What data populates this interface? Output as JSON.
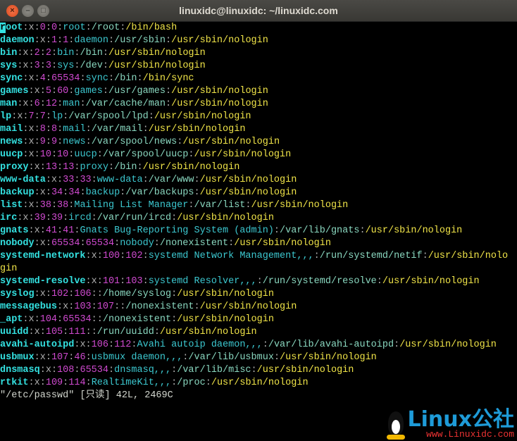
{
  "window": {
    "title": "linuxidc@linuxidc: ~/linuxidc.com"
  },
  "entries": [
    [
      "root",
      "x",
      "0",
      "0",
      "root",
      "/root",
      "/bin/bash"
    ],
    [
      "daemon",
      "x",
      "1",
      "1",
      "daemon",
      "/usr/sbin",
      "/usr/sbin/nologin"
    ],
    [
      "bin",
      "x",
      "2",
      "2",
      "bin",
      "/bin",
      "/usr/sbin/nologin"
    ],
    [
      "sys",
      "x",
      "3",
      "3",
      "sys",
      "/dev",
      "/usr/sbin/nologin"
    ],
    [
      "sync",
      "x",
      "4",
      "65534",
      "sync",
      "/bin",
      "/bin/sync"
    ],
    [
      "games",
      "x",
      "5",
      "60",
      "games",
      "/usr/games",
      "/usr/sbin/nologin"
    ],
    [
      "man",
      "x",
      "6",
      "12",
      "man",
      "/var/cache/man",
      "/usr/sbin/nologin"
    ],
    [
      "lp",
      "x",
      "7",
      "7",
      "lp",
      "/var/spool/lpd",
      "/usr/sbin/nologin"
    ],
    [
      "mail",
      "x",
      "8",
      "8",
      "mail",
      "/var/mail",
      "/usr/sbin/nologin"
    ],
    [
      "news",
      "x",
      "9",
      "9",
      "news",
      "/var/spool/news",
      "/usr/sbin/nologin"
    ],
    [
      "uucp",
      "x",
      "10",
      "10",
      "uucp",
      "/var/spool/uucp",
      "/usr/sbin/nologin"
    ],
    [
      "proxy",
      "x",
      "13",
      "13",
      "proxy",
      "/bin",
      "/usr/sbin/nologin"
    ],
    [
      "www-data",
      "x",
      "33",
      "33",
      "www-data",
      "/var/www",
      "/usr/sbin/nologin"
    ],
    [
      "backup",
      "x",
      "34",
      "34",
      "backup",
      "/var/backups",
      "/usr/sbin/nologin"
    ],
    [
      "list",
      "x",
      "38",
      "38",
      "Mailing List Manager",
      "/var/list",
      "/usr/sbin/nologin"
    ],
    [
      "irc",
      "x",
      "39",
      "39",
      "ircd",
      "/var/run/ircd",
      "/usr/sbin/nologin"
    ],
    [
      "gnats",
      "x",
      "41",
      "41",
      "Gnats Bug-Reporting System (admin)",
      "/var/lib/gnats",
      "/usr/sbin/nologin"
    ],
    [
      "nobody",
      "x",
      "65534",
      "65534",
      "nobody",
      "/nonexistent",
      "/usr/sbin/nologin"
    ],
    [
      "systemd-network",
      "x",
      "100",
      "102",
      "systemd Network Management,,,",
      "/run/systemd/netif",
      "/usr/sbin/nologin"
    ],
    [
      "systemd-resolve",
      "x",
      "101",
      "103",
      "systemd Resolver,,,",
      "/run/systemd/resolve",
      "/usr/sbin/nologin"
    ],
    [
      "syslog",
      "x",
      "102",
      "106",
      "",
      "/home/syslog",
      "/usr/sbin/nologin"
    ],
    [
      "messagebus",
      "x",
      "103",
      "107",
      "",
      "/nonexistent",
      "/usr/sbin/nologin"
    ],
    [
      "_apt",
      "x",
      "104",
      "65534",
      "",
      "/nonexistent",
      "/usr/sbin/nologin"
    ],
    [
      "uuidd",
      "x",
      "105",
      "111",
      "",
      "/run/uuidd",
      "/usr/sbin/nologin"
    ],
    [
      "avahi-autoipd",
      "x",
      "106",
      "112",
      "Avahi autoip daemon,,,",
      "/var/lib/avahi-autoipd",
      "/usr/sbin/nologin"
    ],
    [
      "usbmux",
      "x",
      "107",
      "46",
      "usbmux daemon,,,",
      "/var/lib/usbmux",
      "/usr/sbin/nologin"
    ],
    [
      "dnsmasq",
      "x",
      "108",
      "65534",
      "dnsmasq,,,",
      "/var/lib/misc",
      "/usr/sbin/nologin"
    ],
    [
      "rtkit",
      "x",
      "109",
      "114",
      "RealtimeKit,,,",
      "/proc",
      "/usr/sbin/nologin"
    ]
  ],
  "status_line": "\"/etc/passwd\" [只读] 42L, 2469C",
  "watermark": {
    "brand": "Linux公社",
    "url": "www.Linuxidc.com"
  }
}
